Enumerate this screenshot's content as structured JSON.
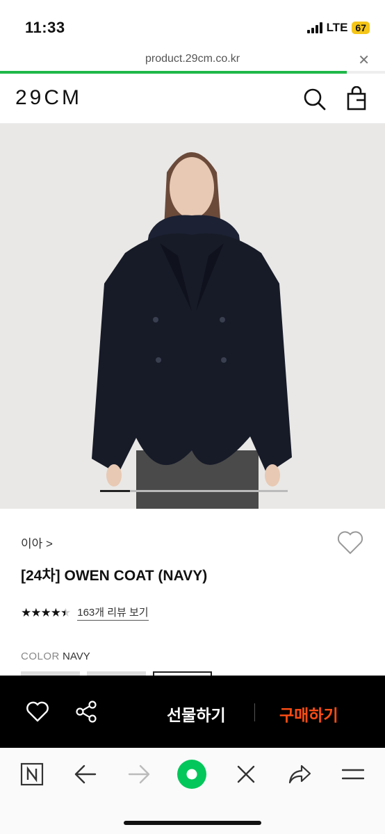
{
  "status_bar": {
    "time": "11:33",
    "network": "LTE",
    "battery": "67"
  },
  "browser": {
    "url": "product.29cm.co.kr",
    "load_progress": 0.9
  },
  "header": {
    "logo": "29CM"
  },
  "gallery": {
    "current_slide": 1,
    "progress": 0.16
  },
  "product": {
    "brand": "이아 >",
    "title": "[24차] OWEN COAT (NAVY)",
    "rating_stars": "★★★★★",
    "rating_value": 4.5,
    "reviews": "163개 리뷰 보기",
    "color_label": "COLOR",
    "color_value": "NAVY"
  },
  "actions": {
    "gift": "선물하기",
    "buy": "구매하기"
  },
  "colors": {
    "progress": "#1fb84a",
    "buy": "#ff4d14",
    "naver_green": "#03c75a"
  }
}
